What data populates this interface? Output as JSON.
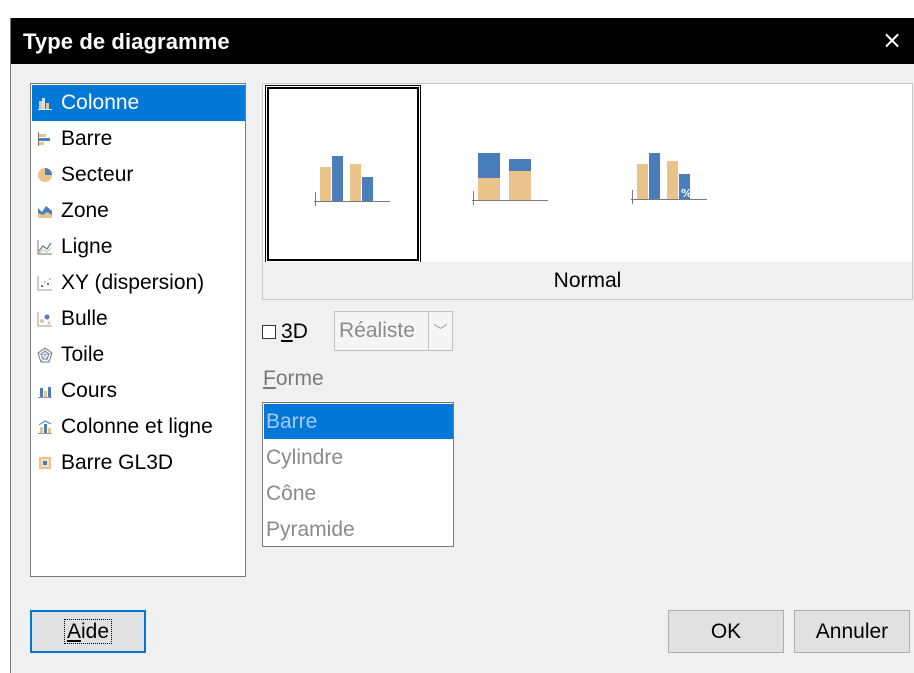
{
  "dialog": {
    "title": "Type de diagramme",
    "close_symbol": "×"
  },
  "chart_types": [
    {
      "label": "Colonne",
      "icon": "column-chart-icon",
      "selected": true
    },
    {
      "label": "Barre",
      "icon": "bar-chart-icon"
    },
    {
      "label": "Secteur",
      "icon": "pie-chart-icon"
    },
    {
      "label": "Zone",
      "icon": "area-chart-icon"
    },
    {
      "label": "Ligne",
      "icon": "line-chart-icon"
    },
    {
      "label": "XY (dispersion)",
      "icon": "scatter-chart-icon"
    },
    {
      "label": "Bulle",
      "icon": "bubble-chart-icon"
    },
    {
      "label": "Toile",
      "icon": "net-chart-icon"
    },
    {
      "label": "Cours",
      "icon": "stock-chart-icon"
    },
    {
      "label": "Colonne et ligne",
      "icon": "column-line-chart-icon"
    },
    {
      "label": "Barre GL3D",
      "icon": "gl3d-bar-chart-icon"
    }
  ],
  "subtypes": {
    "selected_caption": "Normal",
    "items": [
      {
        "icon": "column-normal-icon",
        "selected": true
      },
      {
        "icon": "column-stacked-icon"
      },
      {
        "icon": "column-percent-stacked-icon",
        "badge": "%"
      }
    ]
  },
  "options_3d": {
    "checkbox_label_underlined": "3",
    "checkbox_label_rest": "D",
    "checked": false,
    "scheme_value": "Réaliste",
    "dropdown_symbol": "﹀"
  },
  "shape": {
    "label_underlined": "F",
    "label_rest": "orme",
    "options": [
      "Barre",
      "Cylindre",
      "Cône",
      "Pyramide"
    ],
    "selected_index": 0
  },
  "buttons": {
    "help_underlined": "A",
    "help_rest": "ide",
    "ok": "OK",
    "cancel": "Annuler"
  },
  "colors": {
    "accent": "#0078d7",
    "series_blue": "#4a7ebb",
    "series_tan": "#eac38a"
  }
}
